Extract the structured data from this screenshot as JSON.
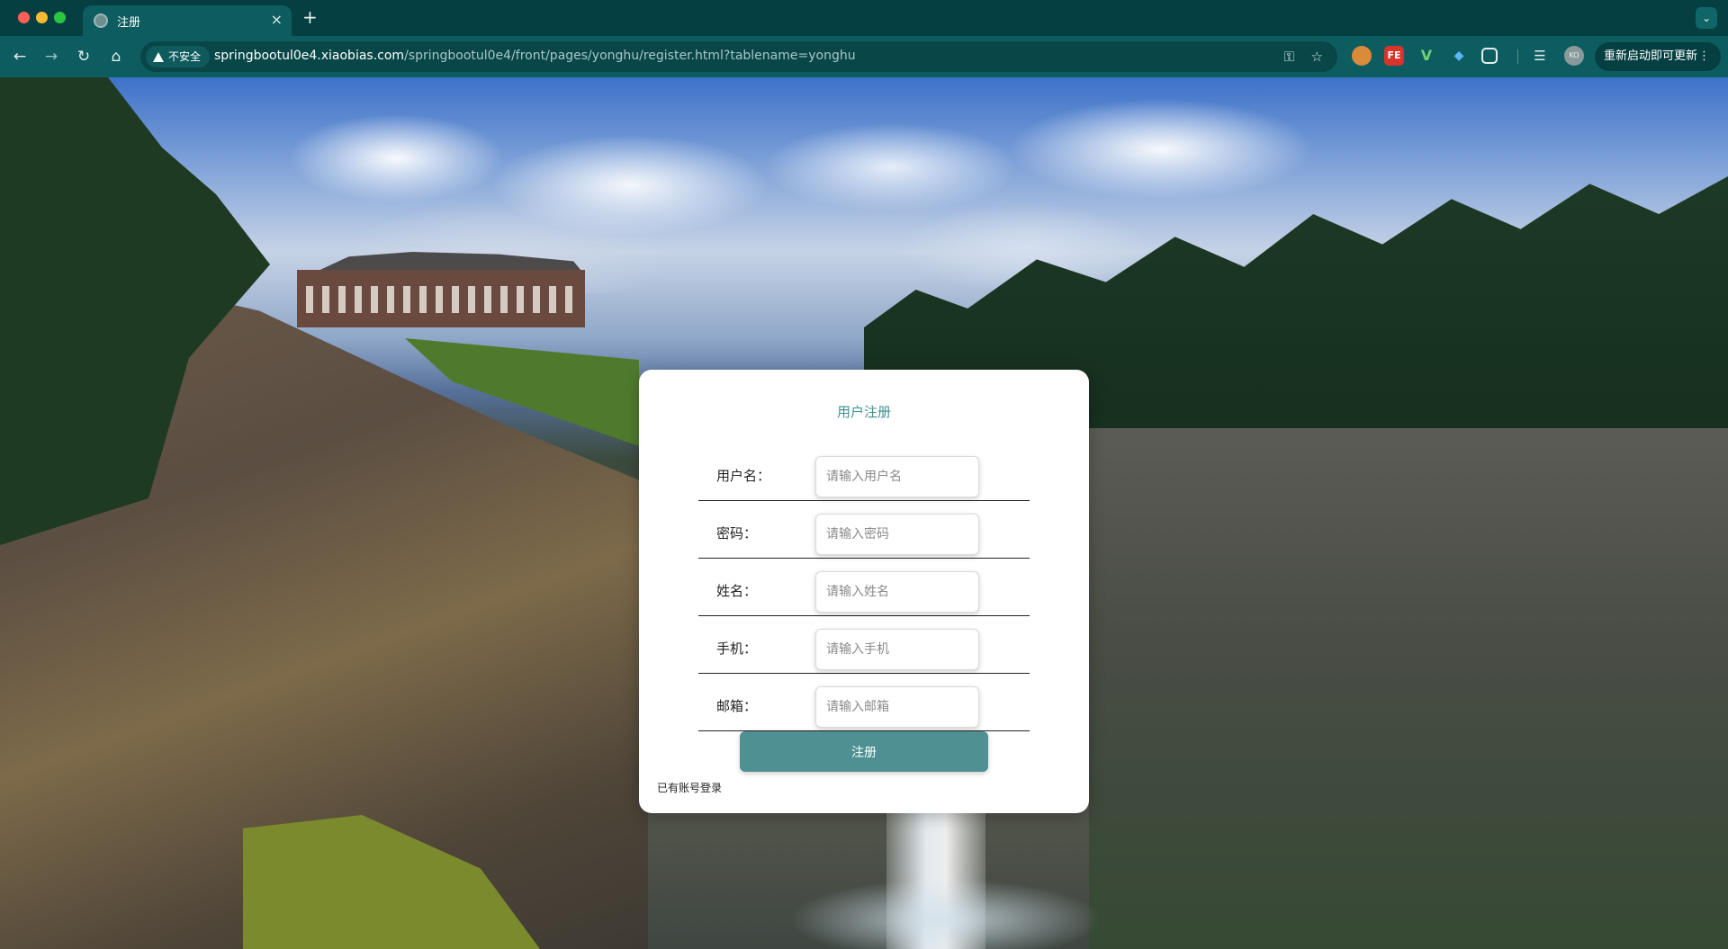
{
  "browser": {
    "tab_title": "注册",
    "new_tab_glyph": "+",
    "close_glyph": "×",
    "security_label": "不安全",
    "url_host": "springbootul0e4.xiaobias.com",
    "url_path": "/springbootul0e4/front/pages/yonghu/register.html?tablename=yonghu",
    "update_button_label": "重新启动即可更新",
    "ext_2_label": "FE",
    "ext_3_label": "V",
    "avatar_label": "KO"
  },
  "register": {
    "title": "用户注册",
    "fields": [
      {
        "label": "用户名：",
        "placeholder": "请输入用户名"
      },
      {
        "label": "密码：",
        "placeholder": "请输入密码"
      },
      {
        "label": "姓名：",
        "placeholder": "请输入姓名"
      },
      {
        "label": "手机：",
        "placeholder": "请输入手机"
      },
      {
        "label": "邮箱：",
        "placeholder": "请输入邮箱"
      }
    ],
    "submit_label": "注册",
    "login_link": "已有账号登录"
  },
  "colors": {
    "chrome_dark": "#063f41",
    "chrome_toolbar": "#0d5d60",
    "accent_title": "#3f8f8f",
    "button_bg": "#4f9092"
  }
}
